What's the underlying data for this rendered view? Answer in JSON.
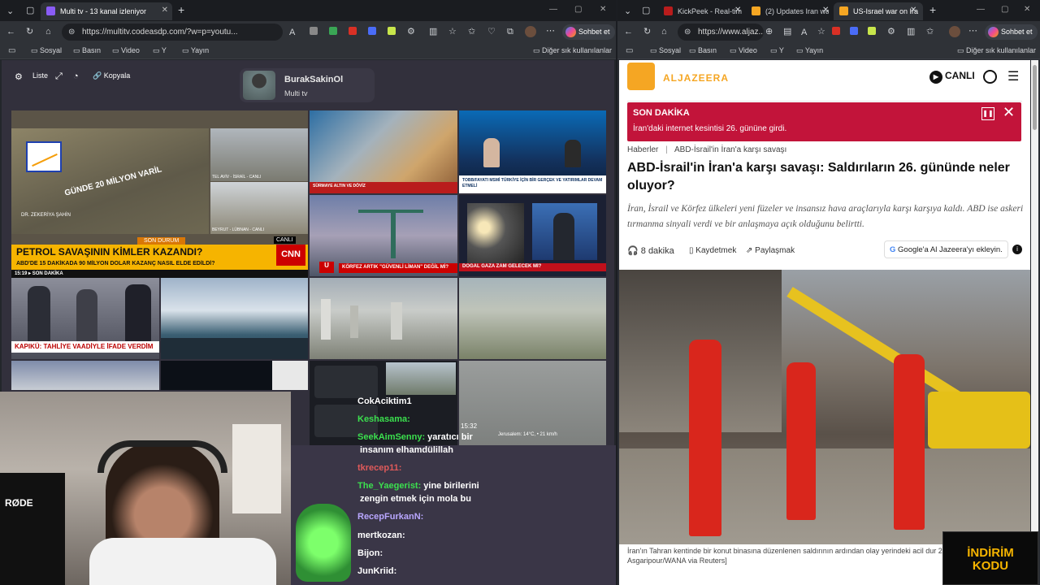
{
  "left_window": {
    "tab_title": "Multi tv - 13 kanal izleniyor",
    "url": "https://multitv.codeasdp.com/?w=p=youtu...",
    "sohbet": "Sohbet et",
    "bookmarks": [
      "Sosyal",
      "Basın",
      "Video",
      "Y",
      "Yayın"
    ],
    "other_bookmarks": "Diğer sık kullanılanlar"
  },
  "right_window": {
    "tabs": [
      "KickPeek - Real-tim",
      "(2) Updates Iran wa",
      "US-Israel war on Ira"
    ],
    "url": "https://www.aljaz...",
    "sohbet": "Sohbet et",
    "bookmarks": [
      "Sosyal",
      "Basın",
      "Video",
      "Y",
      "Yayın"
    ],
    "other_bookmarks": "Diğer sık kullanılanlar"
  },
  "multitv": {
    "toolbar": {
      "list": "Liste",
      "copy": "Kopyala"
    },
    "profile": {
      "name": "BurakSakinOl",
      "subtitle": "Multi tv"
    },
    "cells": {
      "c1_headline": "PETROL SAVAŞININ KİMLER KAZANDI?",
      "c1_sub": "ABD'DE 15 DAKİKADA 90 MİLYON DOLAR KAZANÇ NASIL ELDE EDİLDİ?",
      "c1_tag": "SON DURUM",
      "c1_channel": "CNN",
      "c1_map": "GÜNDE 20 MİLYON VARİL",
      "c1_loc1": "TEL AVİV - İSRAİL - CANLI",
      "c1_loc2": "BEYRUT - LÜBNAN - CANLI",
      "c1_guest": "DR. ZEKERİYA ŞAHİN",
      "c2_caption": "TOBB/FAYATI MSMİ TÜRKİYE İÇİN BİR GERÇEK VE YATIRIMLAR DEVAM ETMELİ",
      "c3_caption": "KÖRFEZ ARTIK \"GÜVENLİ LİMAN\" DEĞİL Mİ?",
      "c4_caption": "DOĞAL GAZA ZAM GELECEK Mİ?",
      "c5_caption": "KAPIKÜ: TAHLİYE VAADİYLE İFADE VERDİM",
      "c6_caption": "Jerusalem: 14°C, • 21 km/h",
      "c6_time": "15:32"
    }
  },
  "chat": [
    {
      "user": "CokAciktim1",
      "text": "",
      "color": "#ffffff"
    },
    {
      "user": "Keshasama:",
      "text": "",
      "color": "#3be04e"
    },
    {
      "user": "SeekAimSenny:",
      "text": "yaratıcı bir",
      "color": "#3be04e"
    },
    {
      "user": "",
      "text": "insanım elhamdülillah",
      "color": "#ffffff"
    },
    {
      "user": "tkrecep11:",
      "text": "",
      "color": "#e05a5a"
    },
    {
      "user": "The_Yaegerist:",
      "text": "yine birilerini",
      "color": "#3be04e"
    },
    {
      "user": "",
      "text": "zengin etmek için mola bu",
      "color": "#ffffff"
    },
    {
      "user": "RecepFurkanN:",
      "text": "",
      "color": "#b9a7ff"
    },
    {
      "user": "mertkozan:",
      "text": "",
      "color": "#ffffff"
    },
    {
      "user": "Bijon:",
      "text": "",
      "color": "#ffffff"
    },
    {
      "user": "JunKriid:",
      "text": "",
      "color": "#ffffff"
    }
  ],
  "webcam": {
    "mic_brand": "RØDE"
  },
  "aljazeera": {
    "brand": "ALJAZEERA",
    "live": "CANLI",
    "breaking_label": "SON DAKİKA",
    "breaking_text": "İran'daki internet kesintisi 26. gününe girdi.",
    "breadcrumb_home": "Haberler",
    "breadcrumb_sep": "|",
    "breadcrumb_topic": "ABD-İsrail'in İran'a karşı savaşı",
    "headline": "ABD-İsrail'in İran'a karşı savaşı: Saldırıların 26. gününde neler oluyor?",
    "summary": "İran, İsrail ve Körfez ülkeleri yeni füzeler ve insansız hava araçlarıyla karşı karşıya kaldı. ABD ise askeri tırmanma sinyali verdi ve bir anlaşmaya açık olduğunu belirtti.",
    "read_time": "8 dakika",
    "save": "Kaydetmek",
    "share": "Paylaşmak",
    "google": "Google'a Al Jazeera'yı ekleyin.",
    "photo_caption": "İran'ın Tahran kentinde bir konut binasına düzenlenen saldırının ardından olay yerindeki acil dur 2026 [Majid Asgaripour/WANA via Reuters]"
  },
  "overlay": {
    "line1": "İNDİRİM",
    "line2": "KODU"
  }
}
